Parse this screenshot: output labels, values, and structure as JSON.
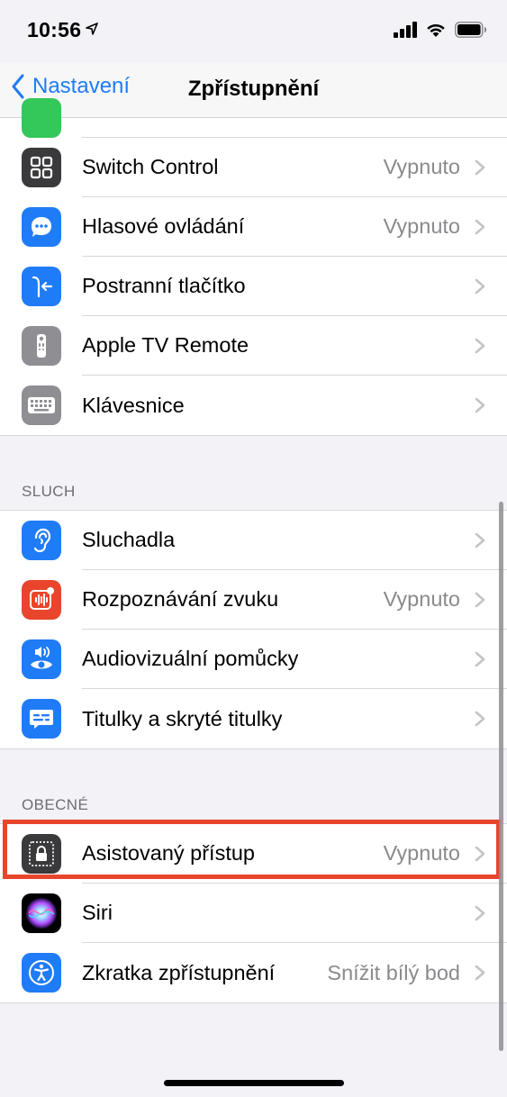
{
  "status_bar": {
    "time": "10:56"
  },
  "nav": {
    "back_label": "Nastavení",
    "title": "Zpřístupnění"
  },
  "group_top": [
    {
      "label": "Switch Control",
      "value": "Vypnuto",
      "icon": "switch-control-icon",
      "color": "#3a3a3c"
    },
    {
      "label": "Hlasové ovládání",
      "value": "Vypnuto",
      "icon": "voice-control-icon",
      "color": "#1f7cf6"
    },
    {
      "label": "Postranní tlačítko",
      "value": "",
      "icon": "side-button-icon",
      "color": "#1f7cf6"
    },
    {
      "label": "Apple TV Remote",
      "value": "",
      "icon": "tv-remote-icon",
      "color": "#8e8e93"
    },
    {
      "label": "Klávesnice",
      "value": "",
      "icon": "keyboard-icon",
      "color": "#8e8e93"
    }
  ],
  "sluch": {
    "header": "SLUCH",
    "items": [
      {
        "label": "Sluchadla",
        "value": "",
        "icon": "ear-icon",
        "color": "#1f7cf6"
      },
      {
        "label": "Rozpoznávání zvuku",
        "value": "Vypnuto",
        "icon": "sound-recognition-icon",
        "color": "#e8452c"
      },
      {
        "label": "Audiovizuální pomůcky",
        "value": "",
        "icon": "audio-visual-icon",
        "color": "#1f7cf6"
      },
      {
        "label": "Titulky a skryté titulky",
        "value": "",
        "icon": "subtitles-icon",
        "color": "#1f7cf6"
      }
    ]
  },
  "obecne": {
    "header": "OBECNÉ",
    "items": [
      {
        "label": "Asistovaný přístup",
        "value": "Vypnuto",
        "icon": "guided-access-icon",
        "color": "#3a3a3c"
      },
      {
        "label": "Siri",
        "value": "",
        "icon": "siri-icon",
        "color": "#000000"
      },
      {
        "label": "Zkratka zpřístupnění",
        "value": "Snížit bílý bod",
        "icon": "accessibility-shortcut-icon",
        "color": "#1f7cf6"
      }
    ]
  },
  "colors": {
    "accent": "#1f7cf6",
    "highlight": "#e8452c"
  }
}
